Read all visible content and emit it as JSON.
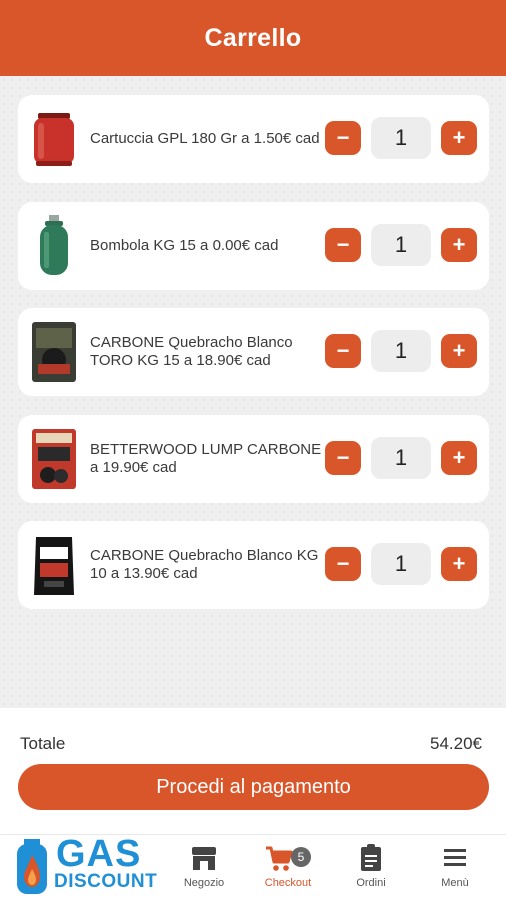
{
  "header": {
    "title": "Carrello"
  },
  "cart": {
    "items": [
      {
        "name": "Cartuccia GPL 180 Gr a 1.50€ cad",
        "quantity": "1",
        "thumb": "gas-cartridge-icon"
      },
      {
        "name": "Bombola KG 15 a 0.00€ cad",
        "quantity": "1",
        "thumb": "gas-cylinder-icon"
      },
      {
        "name": "CARBONE Quebracho Blanco TORO KG 15 a 18.90€ cad",
        "quantity": "1",
        "thumb": "charcoal-bag-icon"
      },
      {
        "name": "BETTERWOOD LUMP CARBONE a 19.90€ cad",
        "quantity": "1",
        "thumb": "charcoal-box-icon"
      },
      {
        "name": "CARBONE Quebracho Blanco KG 10 a 13.90€ cad",
        "quantity": "1",
        "thumb": "charcoal-black-bag-icon"
      }
    ],
    "minus_label": "−",
    "plus_label": "+"
  },
  "summary": {
    "total_label": "Totale",
    "total_value": "54.20€",
    "pay_button": "Procedi al pagamento"
  },
  "logo": {
    "line1": "GAS",
    "line2": "DISCOUNT"
  },
  "nav": {
    "items": [
      {
        "label": "Negozio",
        "icon": "store-icon"
      },
      {
        "label": "Checkout",
        "icon": "cart-icon",
        "badge": "5"
      },
      {
        "label": "Ordini",
        "icon": "clipboard-icon"
      },
      {
        "label": "Menù",
        "icon": "menu-icon"
      }
    ]
  },
  "colors": {
    "accent": "#d9562a",
    "logo_blue": "#1f8fd6"
  }
}
